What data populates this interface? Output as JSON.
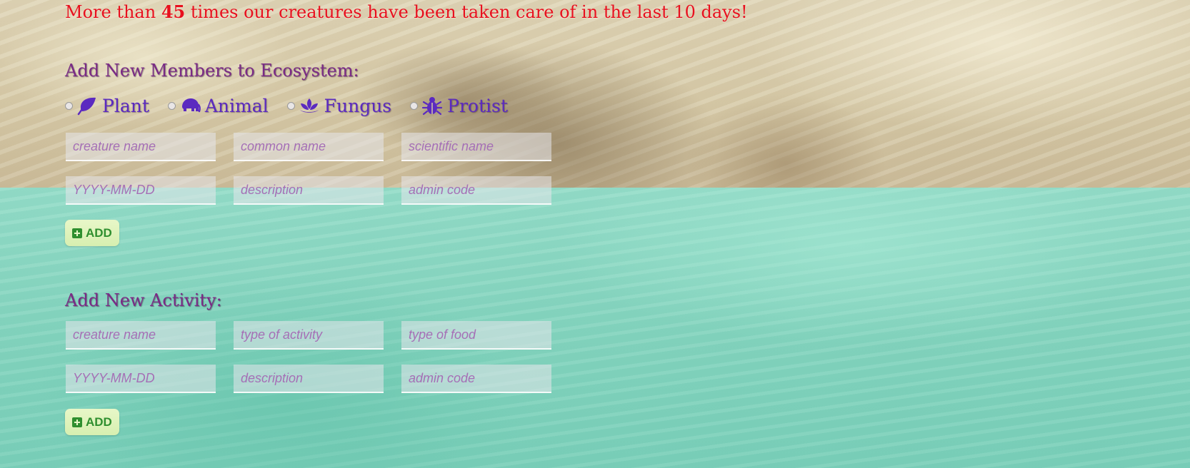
{
  "stats": {
    "prefix": "More than ",
    "count": "45",
    "suffix": " times our creatures have been taken care of in the last 10 days!"
  },
  "add_members": {
    "title": "Add New Members to Ecosystem:",
    "kingdoms": [
      {
        "label": "Plant",
        "icon": "leaf-icon"
      },
      {
        "label": "Animal",
        "icon": "elephant-icon"
      },
      {
        "label": "Fungus",
        "icon": "lotus-icon"
      },
      {
        "label": "Protist",
        "icon": "bug-icon"
      }
    ],
    "fields": {
      "creature_name": "creature name",
      "common_name": "common name",
      "scientific_name": "scientific name",
      "date": "YYYY-MM-DD",
      "description": "description",
      "admin_code": "admin code"
    },
    "add_label": "ADD"
  },
  "add_activity": {
    "title": "Add New Activity:",
    "fields": {
      "creature_name": "creature name",
      "activity_type": "type of activity",
      "food_type": "type of food",
      "date": "YYYY-MM-DD",
      "description": "description",
      "admin_code": "admin code"
    },
    "add_label": "ADD"
  },
  "colors": {
    "stats_text": "#e8101e",
    "section_title": "#7a2a86",
    "kingdom_label": "#5b2ac0",
    "placeholder": "#a56fb6",
    "add_button_text": "#2f8f2f",
    "add_button_bg": "#dff3bc",
    "water": "#86d5bf",
    "sand": "#d4c7a5"
  }
}
